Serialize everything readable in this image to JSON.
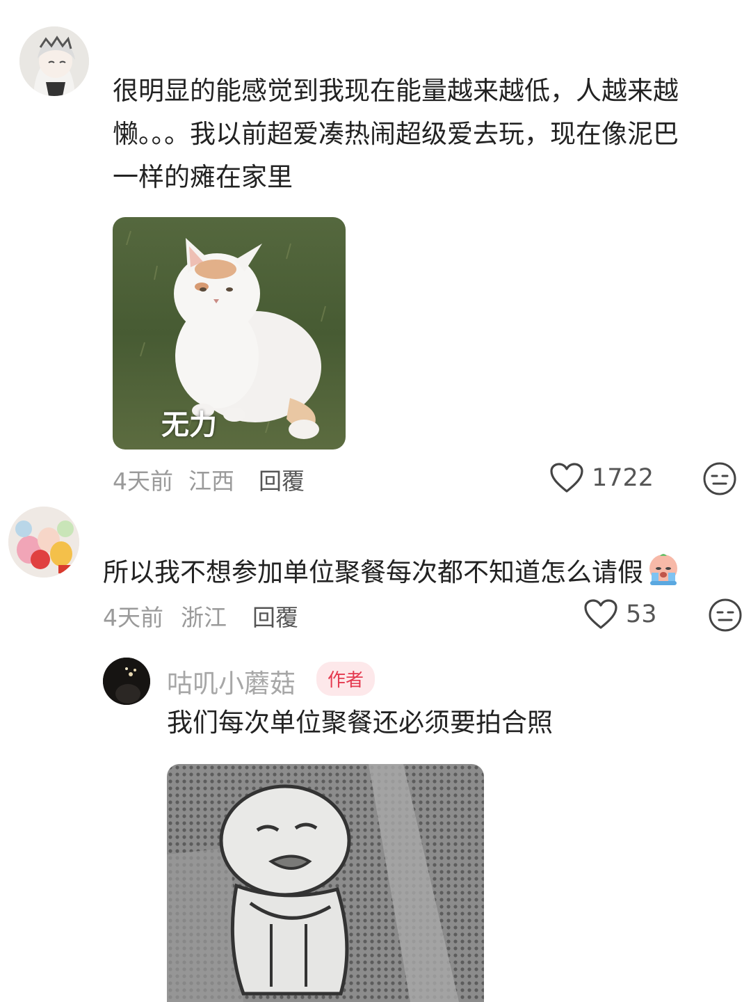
{
  "comments": [
    {
      "text_lines": [
        "很明显的能感觉到我现在能量越来越低，人越来越",
        "懒。。。我以前超爱凑热闹超级爱去玩，现在像泥巴",
        "一样的瘫在家里"
      ],
      "image_caption": "无力",
      "time": "4天前",
      "location": "江西",
      "reply_label": "回覆",
      "likes": "1722",
      "icons": [
        "heart-icon",
        "neutral-face-icon"
      ]
    },
    {
      "text": "所以我不想参加单位聚餐每次都不知道怎么请假",
      "emoji": "crying-face-emoji",
      "time": "4天前",
      "location": "浙江",
      "reply_label": "回覆",
      "likes": "53",
      "icons": [
        "heart-icon",
        "neutral-face-icon"
      ]
    }
  ],
  "reply": {
    "author_name": "咕叽小蘑菇",
    "badge": "作者",
    "text": "我们每次单位聚餐还必须要拍合照"
  }
}
